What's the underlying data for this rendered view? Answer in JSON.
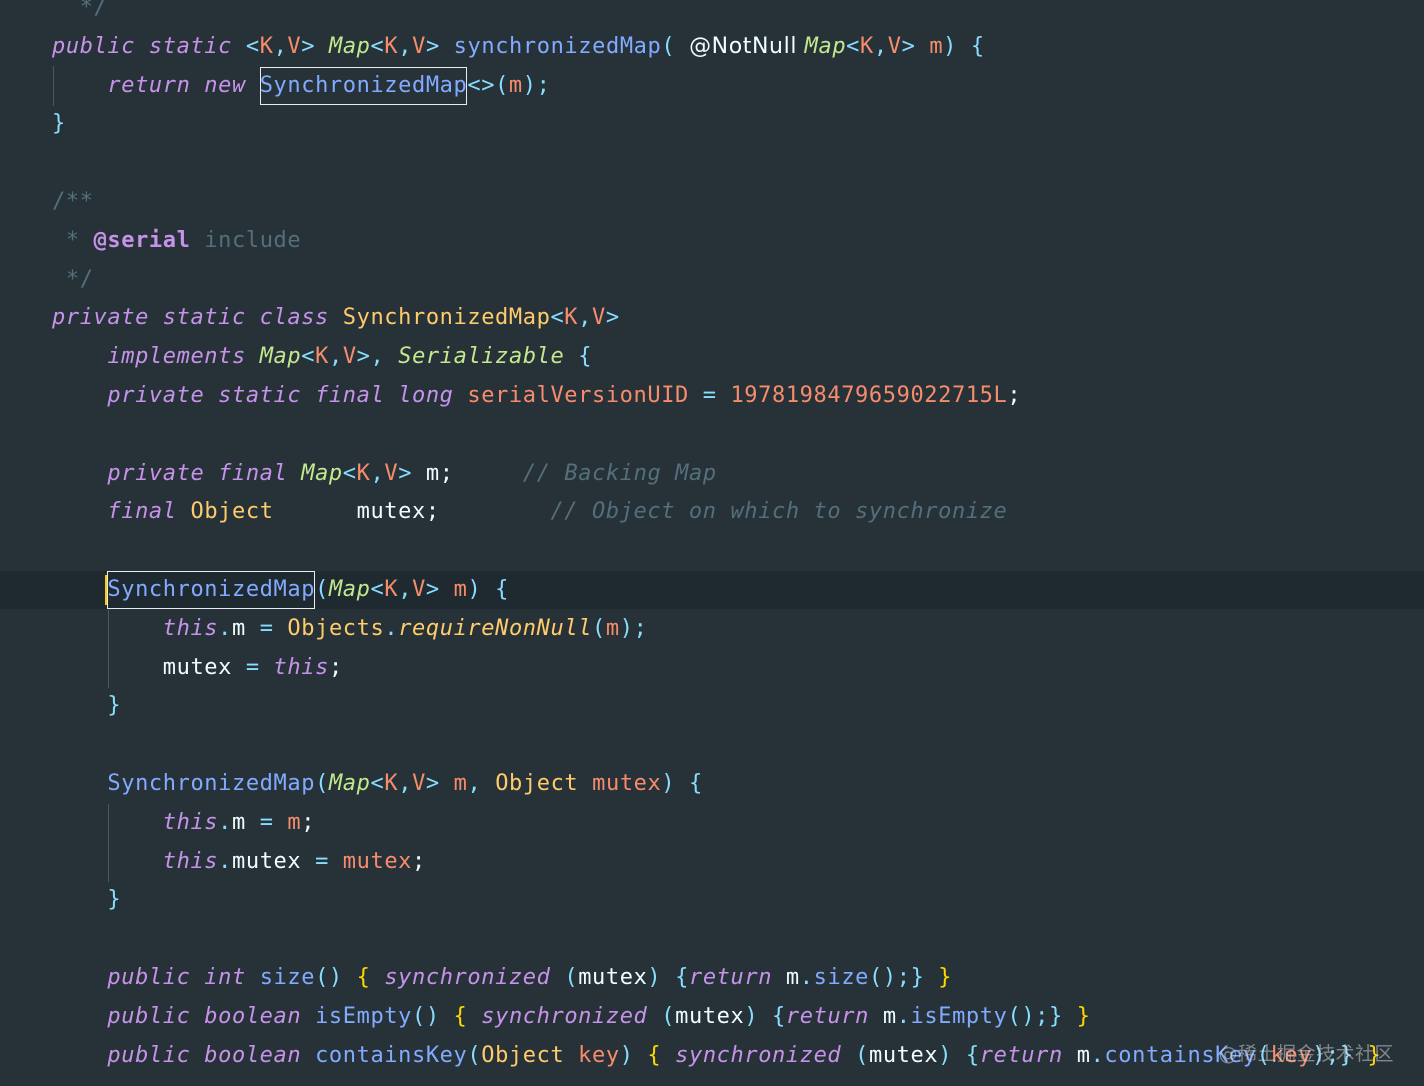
{
  "theme": {
    "background": "#263238",
    "current_line": "#1f2a30",
    "colors": {
      "kw": "#c792ea",
      "type": "#c3e88d",
      "typeparam": "#f78c6c",
      "method": "#82aaff",
      "class": "#ffcb6b",
      "param": "#f78c6c",
      "field": "#eeffff",
      "punct": "#89ddff",
      "brace": "#ffd700",
      "brace2": "#89ddff",
      "comment": "#546e7a",
      "annotation": "#eeffff",
      "tag": "#c792ea",
      "number": "#f78c6c",
      "plain": "#eeffff"
    }
  },
  "code_lines": [
    {
      "tokens": [
        {
          "text": "  */",
          "cls": "comment"
        }
      ]
    },
    {
      "tokens": [
        {
          "text": "public static ",
          "cls": "kw",
          "italic": true
        },
        {
          "text": "<",
          "cls": "punct"
        },
        {
          "text": "K",
          "cls": "typeparam"
        },
        {
          "text": ",",
          "cls": "punct"
        },
        {
          "text": "V",
          "cls": "typeparam"
        },
        {
          "text": "> ",
          "cls": "punct"
        },
        {
          "text": "Map",
          "cls": "type",
          "italic": true
        },
        {
          "text": "<",
          "cls": "punct"
        },
        {
          "text": "K",
          "cls": "typeparam"
        },
        {
          "text": ",",
          "cls": "punct"
        },
        {
          "text": "V",
          "cls": "typeparam"
        },
        {
          "text": "> ",
          "cls": "punct"
        },
        {
          "text": "synchronizedMap",
          "cls": "method"
        },
        {
          "text": "( ",
          "cls": "punct"
        },
        {
          "text": "@NotNull ",
          "cls": "annotation",
          "sans": true
        },
        {
          "text": "Map",
          "cls": "type",
          "italic": true
        },
        {
          "text": "<",
          "cls": "punct"
        },
        {
          "text": "K",
          "cls": "typeparam"
        },
        {
          "text": ",",
          "cls": "punct"
        },
        {
          "text": "V",
          "cls": "typeparam"
        },
        {
          "text": "> ",
          "cls": "punct"
        },
        {
          "text": "m",
          "cls": "param"
        },
        {
          "text": ") {",
          "cls": "punct"
        }
      ]
    },
    {
      "tokens": [
        {
          "text": "    ",
          "cls": "plain"
        },
        {
          "text": "return new ",
          "cls": "kw",
          "italic": true
        },
        {
          "text": "SynchronizedMap",
          "cls": "method",
          "boxed": true
        },
        {
          "text": "<>(",
          "cls": "punct"
        },
        {
          "text": "m",
          "cls": "param"
        },
        {
          "text": ");",
          "cls": "punct"
        }
      ]
    },
    {
      "tokens": [
        {
          "text": "}",
          "cls": "punct"
        }
      ]
    },
    {
      "tokens": []
    },
    {
      "tokens": [
        {
          "text": "/**",
          "cls": "comment"
        }
      ]
    },
    {
      "tokens": [
        {
          "text": " * ",
          "cls": "comment"
        },
        {
          "text": "@serial",
          "cls": "tag",
          "bold": true
        },
        {
          "text": " include",
          "cls": "comment"
        }
      ]
    },
    {
      "tokens": [
        {
          "text": " */",
          "cls": "comment"
        }
      ]
    },
    {
      "tokens": [
        {
          "text": "private static class ",
          "cls": "kw",
          "italic": true
        },
        {
          "text": "SynchronizedMap",
          "cls": "class"
        },
        {
          "text": "<",
          "cls": "punct"
        },
        {
          "text": "K",
          "cls": "typeparam"
        },
        {
          "text": ",",
          "cls": "punct"
        },
        {
          "text": "V",
          "cls": "typeparam"
        },
        {
          "text": ">",
          "cls": "punct"
        }
      ]
    },
    {
      "tokens": [
        {
          "text": "    ",
          "cls": "plain"
        },
        {
          "text": "implements ",
          "cls": "kw",
          "italic": true
        },
        {
          "text": "Map",
          "cls": "type",
          "italic": true
        },
        {
          "text": "<",
          "cls": "punct"
        },
        {
          "text": "K",
          "cls": "typeparam"
        },
        {
          "text": ",",
          "cls": "punct"
        },
        {
          "text": "V",
          "cls": "typeparam"
        },
        {
          "text": ">, ",
          "cls": "punct"
        },
        {
          "text": "Serializable",
          "cls": "type",
          "italic": true
        },
        {
          "text": " {",
          "cls": "punct"
        }
      ]
    },
    {
      "tokens": [
        {
          "text": "    ",
          "cls": "plain"
        },
        {
          "text": "private static final long ",
          "cls": "kw",
          "italic": true
        },
        {
          "text": "serialVersionUID",
          "cls": "param"
        },
        {
          "text": " = ",
          "cls": "punct"
        },
        {
          "text": "1978198479659022715L",
          "cls": "number"
        },
        {
          "text": ";",
          "cls": "plain"
        }
      ]
    },
    {
      "tokens": []
    },
    {
      "tokens": [
        {
          "text": "    ",
          "cls": "plain"
        },
        {
          "text": "private final ",
          "cls": "kw",
          "italic": true
        },
        {
          "text": "Map",
          "cls": "type",
          "italic": true
        },
        {
          "text": "<",
          "cls": "punct"
        },
        {
          "text": "K",
          "cls": "typeparam"
        },
        {
          "text": ",",
          "cls": "punct"
        },
        {
          "text": "V",
          "cls": "typeparam"
        },
        {
          "text": "> ",
          "cls": "punct"
        },
        {
          "text": "m",
          "cls": "plain"
        },
        {
          "text": ";",
          "cls": "plain"
        },
        {
          "text": "     // Backing Map",
          "cls": "comment",
          "italic": true
        }
      ]
    },
    {
      "tokens": [
        {
          "text": "    ",
          "cls": "plain"
        },
        {
          "text": "final ",
          "cls": "kw",
          "italic": true
        },
        {
          "text": "Object",
          "cls": "class"
        },
        {
          "text": "      mutex",
          "cls": "plain"
        },
        {
          "text": ";",
          "cls": "plain"
        },
        {
          "text": "        // Object on which to synchronize",
          "cls": "comment",
          "italic": true
        }
      ]
    },
    {
      "tokens": []
    },
    {
      "current": true,
      "tokens": [
        {
          "text": "    ",
          "cls": "plain"
        },
        {
          "text": "SynchronizedMap",
          "cls": "method",
          "boxed": true
        },
        {
          "text": "(",
          "cls": "punct"
        },
        {
          "text": "Map",
          "cls": "type",
          "italic": true
        },
        {
          "text": "<",
          "cls": "punct"
        },
        {
          "text": "K",
          "cls": "typeparam"
        },
        {
          "text": ",",
          "cls": "punct"
        },
        {
          "text": "V",
          "cls": "typeparam"
        },
        {
          "text": "> ",
          "cls": "punct"
        },
        {
          "text": "m",
          "cls": "param"
        },
        {
          "text": ") {",
          "cls": "punct"
        }
      ]
    },
    {
      "tokens": [
        {
          "text": "        ",
          "cls": "plain"
        },
        {
          "text": "this",
          "cls": "kw",
          "italic": true
        },
        {
          "text": ".",
          "cls": "punct"
        },
        {
          "text": "m",
          "cls": "plain"
        },
        {
          "text": " = ",
          "cls": "punct"
        },
        {
          "text": "Objects",
          "cls": "class"
        },
        {
          "text": ".",
          "cls": "punct"
        },
        {
          "text": "requireNonNull",
          "cls": "class",
          "italic": true
        },
        {
          "text": "(",
          "cls": "punct"
        },
        {
          "text": "m",
          "cls": "param"
        },
        {
          "text": ");",
          "cls": "punct"
        }
      ]
    },
    {
      "tokens": [
        {
          "text": "        ",
          "cls": "plain"
        },
        {
          "text": "mutex",
          "cls": "plain"
        },
        {
          "text": " = ",
          "cls": "punct"
        },
        {
          "text": "this",
          "cls": "kw",
          "italic": true
        },
        {
          "text": ";",
          "cls": "plain"
        }
      ]
    },
    {
      "tokens": [
        {
          "text": "    ",
          "cls": "plain"
        },
        {
          "text": "}",
          "cls": "punct"
        }
      ]
    },
    {
      "tokens": []
    },
    {
      "tokens": [
        {
          "text": "    ",
          "cls": "plain"
        },
        {
          "text": "SynchronizedMap",
          "cls": "method"
        },
        {
          "text": "(",
          "cls": "punct"
        },
        {
          "text": "Map",
          "cls": "type",
          "italic": true
        },
        {
          "text": "<",
          "cls": "punct"
        },
        {
          "text": "K",
          "cls": "typeparam"
        },
        {
          "text": ",",
          "cls": "punct"
        },
        {
          "text": "V",
          "cls": "typeparam"
        },
        {
          "text": "> ",
          "cls": "punct"
        },
        {
          "text": "m",
          "cls": "param"
        },
        {
          "text": ", ",
          "cls": "punct"
        },
        {
          "text": "Object",
          "cls": "class"
        },
        {
          "text": " ",
          "cls": "plain"
        },
        {
          "text": "mutex",
          "cls": "param"
        },
        {
          "text": ") {",
          "cls": "punct"
        }
      ]
    },
    {
      "tokens": [
        {
          "text": "        ",
          "cls": "plain"
        },
        {
          "text": "this",
          "cls": "kw",
          "italic": true
        },
        {
          "text": ".",
          "cls": "punct"
        },
        {
          "text": "m",
          "cls": "plain"
        },
        {
          "text": " = ",
          "cls": "punct"
        },
        {
          "text": "m",
          "cls": "param"
        },
        {
          "text": ";",
          "cls": "plain"
        }
      ]
    },
    {
      "tokens": [
        {
          "text": "        ",
          "cls": "plain"
        },
        {
          "text": "this",
          "cls": "kw",
          "italic": true
        },
        {
          "text": ".",
          "cls": "punct"
        },
        {
          "text": "mutex",
          "cls": "plain"
        },
        {
          "text": " = ",
          "cls": "punct"
        },
        {
          "text": "mutex",
          "cls": "param"
        },
        {
          "text": ";",
          "cls": "plain"
        }
      ]
    },
    {
      "tokens": [
        {
          "text": "    ",
          "cls": "plain"
        },
        {
          "text": "}",
          "cls": "punct"
        }
      ]
    },
    {
      "tokens": []
    },
    {
      "tokens": [
        {
          "text": "    ",
          "cls": "plain"
        },
        {
          "text": "public int ",
          "cls": "kw",
          "italic": true
        },
        {
          "text": "size",
          "cls": "method"
        },
        {
          "text": "() ",
          "cls": "punct"
        },
        {
          "text": "{ ",
          "cls": "brace"
        },
        {
          "text": "synchronized ",
          "cls": "kw",
          "italic": true
        },
        {
          "text": "(",
          "cls": "punct"
        },
        {
          "text": "mutex",
          "cls": "plain"
        },
        {
          "text": ") ",
          "cls": "punct"
        },
        {
          "text": "{",
          "cls": "brace2"
        },
        {
          "text": "return ",
          "cls": "kw",
          "italic": true
        },
        {
          "text": "m",
          "cls": "plain"
        },
        {
          "text": ".",
          "cls": "punct"
        },
        {
          "text": "size",
          "cls": "method"
        },
        {
          "text": "();",
          "cls": "punct"
        },
        {
          "text": "} ",
          "cls": "brace2"
        },
        {
          "text": "}",
          "cls": "brace"
        }
      ]
    },
    {
      "tokens": [
        {
          "text": "    ",
          "cls": "plain"
        },
        {
          "text": "public boolean ",
          "cls": "kw",
          "italic": true
        },
        {
          "text": "isEmpty",
          "cls": "method"
        },
        {
          "text": "() ",
          "cls": "punct"
        },
        {
          "text": "{ ",
          "cls": "brace"
        },
        {
          "text": "synchronized ",
          "cls": "kw",
          "italic": true
        },
        {
          "text": "(",
          "cls": "punct"
        },
        {
          "text": "mutex",
          "cls": "plain"
        },
        {
          "text": ") ",
          "cls": "punct"
        },
        {
          "text": "{",
          "cls": "brace2"
        },
        {
          "text": "return ",
          "cls": "kw",
          "italic": true
        },
        {
          "text": "m",
          "cls": "plain"
        },
        {
          "text": ".",
          "cls": "punct"
        },
        {
          "text": "isEmpty",
          "cls": "method"
        },
        {
          "text": "();",
          "cls": "punct"
        },
        {
          "text": "} ",
          "cls": "brace2"
        },
        {
          "text": "}",
          "cls": "brace"
        }
      ]
    },
    {
      "tokens": [
        {
          "text": "    ",
          "cls": "plain"
        },
        {
          "text": "public boolean ",
          "cls": "kw",
          "italic": true
        },
        {
          "text": "containsKey",
          "cls": "method"
        },
        {
          "text": "(",
          "cls": "punct"
        },
        {
          "text": "Object",
          "cls": "class"
        },
        {
          "text": " ",
          "cls": "plain"
        },
        {
          "text": "key",
          "cls": "param"
        },
        {
          "text": ") ",
          "cls": "punct"
        },
        {
          "text": "{ ",
          "cls": "brace"
        },
        {
          "text": "synchronized ",
          "cls": "kw",
          "italic": true
        },
        {
          "text": "(",
          "cls": "punct"
        },
        {
          "text": "mutex",
          "cls": "plain"
        },
        {
          "text": ") ",
          "cls": "punct"
        },
        {
          "text": "{",
          "cls": "brace2"
        },
        {
          "text": "return ",
          "cls": "kw",
          "italic": true
        },
        {
          "text": "m",
          "cls": "plain"
        },
        {
          "text": ".",
          "cls": "punct"
        },
        {
          "text": "containsKey",
          "cls": "method"
        },
        {
          "text": "(",
          "cls": "punct"
        },
        {
          "text": "key",
          "cls": "param"
        },
        {
          "text": ");",
          "cls": "punct"
        },
        {
          "text": "} ",
          "cls": "brace2"
        },
        {
          "text": "}",
          "cls": "brace"
        }
      ]
    }
  ],
  "watermark": "@稀土掘金技术社区"
}
